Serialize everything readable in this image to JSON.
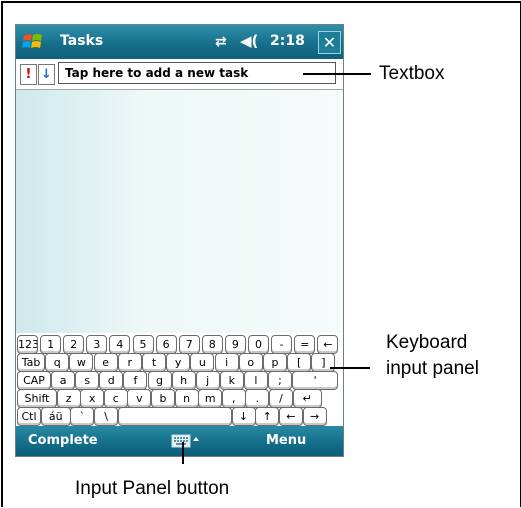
{
  "titlebar": {
    "app_title": "Tasks",
    "clock": "2:18",
    "close_label": "✕",
    "sync_icon": "⇄",
    "volume_icon": "◀("
  },
  "task_entry": {
    "priority_high": "!",
    "priority_low": "↓",
    "placeholder": "Tap here to add a new task"
  },
  "keyboard": {
    "rows": [
      [
        "123",
        "1",
        "2",
        "3",
        "4",
        "5",
        "6",
        "7",
        "8",
        "9",
        "0",
        "-",
        "=",
        "←"
      ],
      [
        "Tab",
        "q",
        "w",
        "e",
        "r",
        "t",
        "y",
        "u",
        "i",
        "o",
        "p",
        "[",
        "]"
      ],
      [
        "CAP",
        "a",
        "s",
        "d",
        "f",
        "g",
        "h",
        "j",
        "k",
        "l",
        ";",
        "'"
      ],
      [
        "Shift",
        "z",
        "x",
        "c",
        "v",
        "b",
        "n",
        "m",
        ",",
        ".",
        "/",
        "↵"
      ],
      [
        "Ctl",
        "áü",
        "`",
        "\\",
        " ",
        "↓",
        "↑",
        "←",
        "→"
      ]
    ]
  },
  "bottombar": {
    "left_softkey": "Complete",
    "right_softkey": "Menu"
  },
  "annotations": {
    "textbox": "Textbox",
    "keyboard_line1": "Keyboard",
    "keyboard_line2": "input panel",
    "input_panel_button": "Input Panel button"
  },
  "colors": {
    "titlebar": "#176f8b",
    "bottombar": "#136c88",
    "content_bg": "#dcecef"
  }
}
